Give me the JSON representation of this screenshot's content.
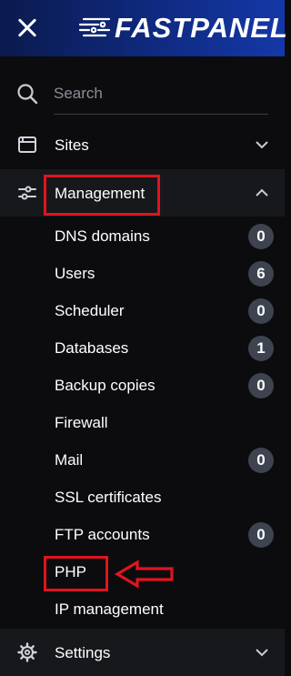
{
  "header": {
    "logo_text": "FASTPANEL"
  },
  "search": {
    "placeholder": "Search"
  },
  "nav": {
    "sites": {
      "label": "Sites"
    },
    "management": {
      "label": "Management",
      "items": [
        {
          "label": "DNS domains",
          "badge": "0"
        },
        {
          "label": "Users",
          "badge": "6"
        },
        {
          "label": "Scheduler",
          "badge": "0"
        },
        {
          "label": "Databases",
          "badge": "1"
        },
        {
          "label": "Backup copies",
          "badge": "0"
        },
        {
          "label": "Firewall"
        },
        {
          "label": "Mail",
          "badge": "0"
        },
        {
          "label": "SSL certificates"
        },
        {
          "label": "FTP accounts",
          "badge": "0"
        },
        {
          "label": "PHP"
        },
        {
          "label": "IP management"
        }
      ]
    },
    "settings": {
      "label": "Settings"
    }
  },
  "colors": {
    "header_gradient_start": "#0b1a4e",
    "header_gradient_end": "#1438a8",
    "background": "#0c0c0f",
    "active_row": "#17181c",
    "badge": "#3e4350",
    "highlight": "#e0141e"
  }
}
